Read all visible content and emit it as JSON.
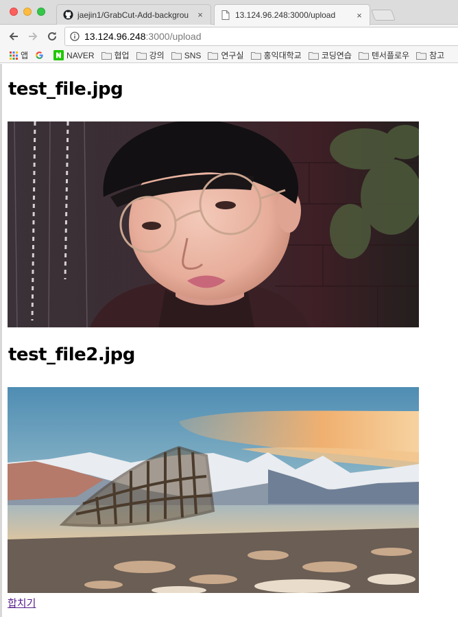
{
  "browser": {
    "tabs": [
      {
        "label": "jaejin1/GrabCut-Add-backgrou",
        "icon": "github-icon",
        "active": false
      },
      {
        "label": "13.124.96.248:3000/upload",
        "icon": "page-icon",
        "active": true
      }
    ],
    "close_glyph": "×",
    "address": {
      "host": "13.124.96.248",
      "path": ":3000/upload"
    },
    "bookmarks": [
      {
        "label": "앱",
        "icon": "apps-grid-icon"
      },
      {
        "label": "",
        "icon": "google-icon"
      },
      {
        "label": "NAVER",
        "icon": "naver-icon"
      },
      {
        "label": "협업",
        "icon": "folder-icon"
      },
      {
        "label": "강의",
        "icon": "folder-icon"
      },
      {
        "label": "SNS",
        "icon": "folder-icon"
      },
      {
        "label": "연구실",
        "icon": "folder-icon"
      },
      {
        "label": "홍익대학교",
        "icon": "folder-icon"
      },
      {
        "label": "코딩연습",
        "icon": "folder-icon"
      },
      {
        "label": "텐서플로우",
        "icon": "folder-icon"
      },
      {
        "label": "참고",
        "icon": "folder-icon"
      }
    ]
  },
  "page": {
    "files": [
      {
        "name": "test_file.jpg"
      },
      {
        "name": "test_file2.jpg"
      }
    ],
    "merge_link": "합치기"
  },
  "colors": {
    "link_visited": "#551a8b",
    "tabbar_bg": "#dcdcdc",
    "toolbar_bg": "#f6f6f6"
  }
}
